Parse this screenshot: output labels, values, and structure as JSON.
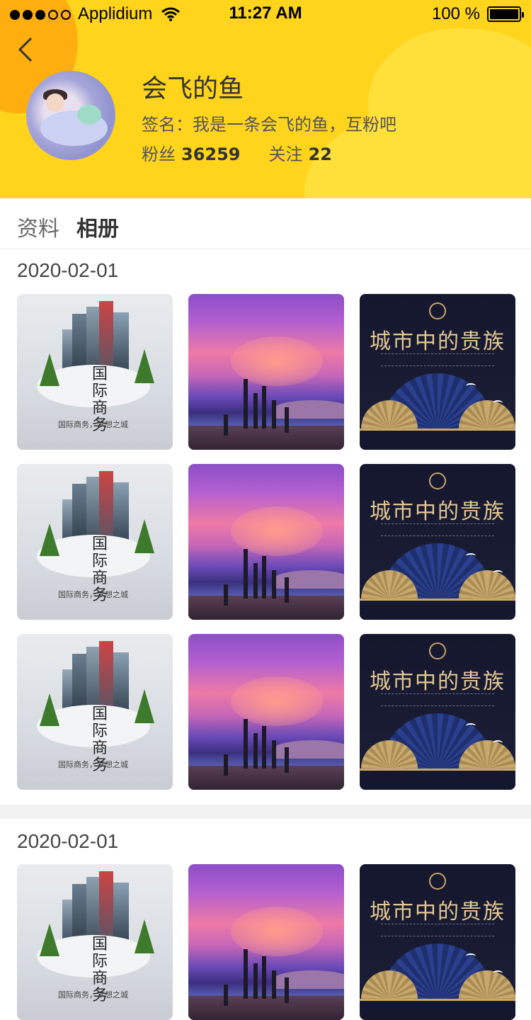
{
  "status_bar": {
    "carrier": "Applidium",
    "time": "11:27 AM",
    "battery": "100 %"
  },
  "profile": {
    "name": "会飞的鱼",
    "signature": "签名：我是一条会飞的鱼，互粉吧",
    "fans_label": "粉丝",
    "fans_count": "36259",
    "follow_label": "关注",
    "follow_count": "22"
  },
  "tabs": [
    {
      "label": "资料",
      "active": false
    },
    {
      "label": "相册",
      "active": true
    }
  ],
  "albums": [
    {
      "date": "2020-02-01",
      "photos": [
        {
          "kind": "city-poster",
          "title": "国际商务",
          "caption": "国际商务，梦想之城"
        },
        {
          "kind": "purple-sky"
        },
        {
          "kind": "fan-poster",
          "title": "城市中的贵族"
        },
        {
          "kind": "city-poster",
          "title": "国际商务",
          "caption": "国际商务，梦想之城"
        },
        {
          "kind": "purple-sky"
        },
        {
          "kind": "fan-poster",
          "title": "城市中的贵族"
        },
        {
          "kind": "city-poster",
          "title": "国际商务",
          "caption": "国际商务，梦想之城"
        },
        {
          "kind": "purple-sky"
        },
        {
          "kind": "fan-poster",
          "title": "城市中的贵族"
        }
      ]
    },
    {
      "date": "2020-02-01",
      "photos": [
        {
          "kind": "city-poster",
          "title": "国际商务",
          "caption": "国际商务，梦想之城"
        },
        {
          "kind": "purple-sky"
        },
        {
          "kind": "fan-poster",
          "title": "城市中的贵族"
        }
      ]
    }
  ],
  "colors": {
    "header": "#ffd41c",
    "accent_orange": "#ffae0f"
  }
}
